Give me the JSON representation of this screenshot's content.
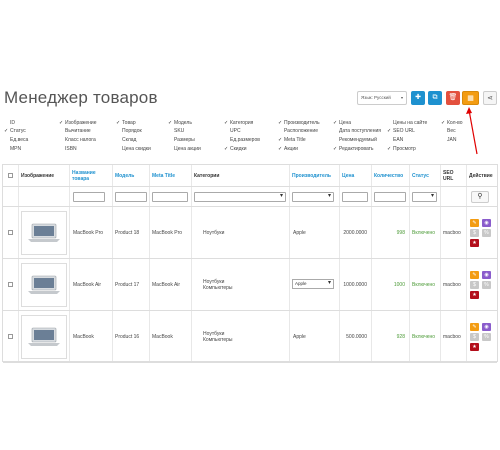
{
  "page_title": "Менеджер товаров",
  "language_select": "Язык: Русский",
  "toolbar": {
    "add_icon": "plus-icon",
    "copy_icon": "copy-icon",
    "delete_icon": "trash-icon",
    "columns_icon": "columns-icon",
    "share_icon": "share-icon",
    "add_glyph": "✚",
    "copy_glyph": "⧉",
    "delete_glyph": "🗑",
    "columns_glyph": "▦",
    "share_glyph": "⋖"
  },
  "column_options": [
    {
      "label": "ID",
      "checked": false
    },
    {
      "label": "Изображение",
      "checked": true
    },
    {
      "label": "Товар",
      "checked": true
    },
    {
      "label": "Модель",
      "checked": true
    },
    {
      "label": "Категория",
      "checked": true
    },
    {
      "label": "Производитель",
      "checked": true
    },
    {
      "label": "Цена",
      "checked": true
    },
    {
      "label": "Цены на сайте",
      "checked": false
    },
    {
      "label": "Кол-во",
      "checked": true
    },
    {
      "label": "Статус",
      "checked": true
    },
    {
      "label": "Вычитание",
      "checked": false
    },
    {
      "label": "Порядок",
      "checked": false
    },
    {
      "label": "SKU",
      "checked": false
    },
    {
      "label": "UPC",
      "checked": false
    },
    {
      "label": "Расположение",
      "checked": false
    },
    {
      "label": "Дата поступления",
      "checked": false
    },
    {
      "label": "SEO URL",
      "checked": true
    },
    {
      "label": "Вес",
      "checked": false
    },
    {
      "label": "Ед.веса",
      "checked": false
    },
    {
      "label": "Класс налога",
      "checked": false
    },
    {
      "label": "Склад",
      "checked": false
    },
    {
      "label": "Размеры",
      "checked": false
    },
    {
      "label": "Ед.размеров",
      "checked": false
    },
    {
      "label": "Meta Title",
      "checked": true
    },
    {
      "label": "Рекомендуемый",
      "checked": false
    },
    {
      "label": "EAN",
      "checked": false
    },
    {
      "label": "JAN",
      "checked": false
    },
    {
      "label": "MPN",
      "checked": false
    },
    {
      "label": "ISBN",
      "checked": false
    },
    {
      "label": "Цена скидки",
      "checked": false
    },
    {
      "label": "Цена акции",
      "checked": false
    },
    {
      "label": "Скидки",
      "checked": true
    },
    {
      "label": "Акции",
      "checked": true
    },
    {
      "label": "Редактировать",
      "checked": true
    },
    {
      "label": "Просмотр",
      "checked": true
    }
  ],
  "table": {
    "headers": {
      "image": "Изображение",
      "name": "Название товара",
      "model": "Модель",
      "meta_title": "Meta Title",
      "category": "Категории",
      "manufacturer": "Производитель",
      "price": "Цена",
      "quantity": "Количество",
      "status": "Статус",
      "seo_url": "SEO URL",
      "action": "Действие"
    },
    "filter_search_icon": "search-icon",
    "rows": [
      {
        "name": "MacBook Pro",
        "model": "Product 18",
        "meta_title": "MacBook Pro",
        "categories": [
          "Ноутбуки"
        ],
        "manufacturer": "Apple",
        "manufacturer_select": false,
        "price": "2000.0000",
        "quantity": "998",
        "status": "Включено",
        "seo_url": "macboo"
      },
      {
        "name": "MacBook Air",
        "model": "Product 17",
        "meta_title": "MacBook Air",
        "categories": [
          "Ноутбуки",
          "Компьютеры"
        ],
        "manufacturer": "Apple",
        "manufacturer_select": true,
        "price": "1000.0000",
        "quantity": "1000",
        "status": "Включено",
        "seo_url": "macboo"
      },
      {
        "name": "MacBook",
        "model": "Product 16",
        "meta_title": "MacBook",
        "categories": [
          "Ноутбуки",
          "Компьютеры"
        ],
        "manufacturer": "Apple",
        "manufacturer_select": false,
        "price": "500.0000",
        "quantity": "928",
        "status": "Включено",
        "seo_url": "macboo"
      }
    ]
  },
  "colors": {
    "primary": "#1e91cf",
    "danger": "#e3503e",
    "warning": "#f39c12",
    "success": "#4b9a36",
    "view": "#8a5ccc",
    "annotation_arrow": "#e00000"
  }
}
